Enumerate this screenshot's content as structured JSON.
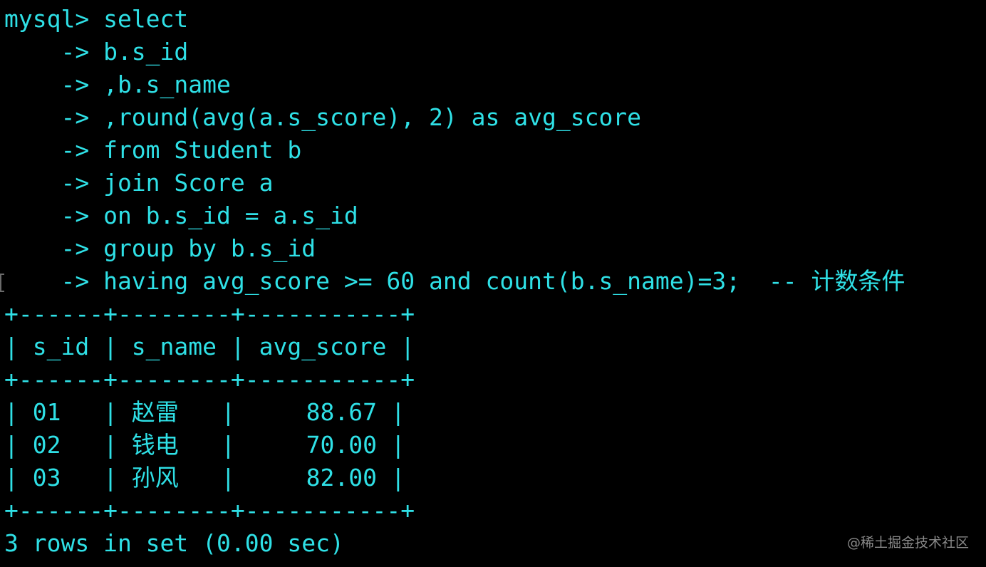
{
  "terminal": {
    "query_lines": [
      "mysql> select",
      "    -> b.s_id",
      "    -> ,b.s_name",
      "    -> ,round(avg(a.s_score), 2) as avg_score",
      "    -> from Student b",
      "    -> join Score a",
      "    -> on b.s_id = a.s_id",
      "    -> group by b.s_id",
      "    -> having avg_score >= 60 and count(b.s_name)=3;  -- 计数条件"
    ],
    "table": {
      "border": "+------+--------+-----------+",
      "header_row": "| s_id | s_name | avg_score |",
      "rows": [
        "| 01   | 赵雷   |     88.67 |",
        "| 02   | 钱电   |     70.00 |",
        "| 03   | 孙风   |     82.00 |"
      ]
    },
    "result_summary": "3 rows in set (0.00 sec)"
  },
  "watermark": "@稀土掘金技术社区",
  "colors": {
    "background": "#000000",
    "text": "#2fe0e6",
    "watermark": "#8a8a8a"
  }
}
